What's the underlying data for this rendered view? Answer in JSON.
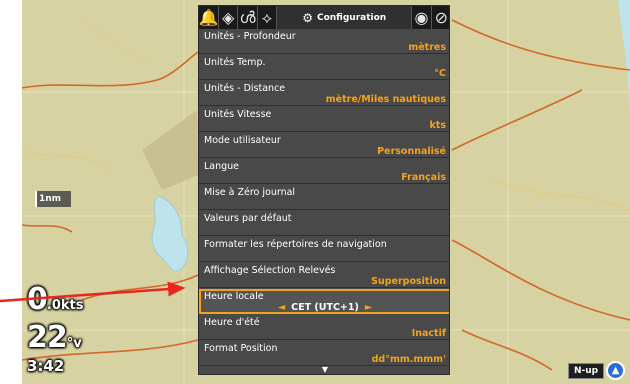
{
  "map": {
    "scale_label": "1nm",
    "orientation_label": "N-up",
    "colors": {
      "land": "#d7d2a2",
      "water": "#bfe3ec",
      "road": "#d4672b",
      "grid": "#ffffff"
    }
  },
  "readouts": {
    "speed_value": "0",
    "speed_unit": ".0kts",
    "depth_value": "22",
    "depth_unit": "°v",
    "time": "3:42"
  },
  "menu": {
    "tabs": [
      {
        "icon": "bell-icon",
        "glyph": "🔔"
      },
      {
        "icon": "navigation-icon",
        "glyph": "◈"
      },
      {
        "icon": "fish-icon",
        "glyph": "ൾ"
      },
      {
        "icon": "antenna-icon",
        "glyph": "⟡"
      }
    ],
    "active_tab": {
      "icon": "gear-icon",
      "glyph": "⚙",
      "label": "Configuration"
    },
    "right_tabs": [
      {
        "icon": "eye-icon",
        "glyph": "◉"
      },
      {
        "icon": "sonar-icon",
        "glyph": "⊘"
      }
    ],
    "items": [
      {
        "label": "Unités - Profondeur",
        "value": "mètres"
      },
      {
        "label": "Unités Temp.",
        "value": "°C"
      },
      {
        "label": "Unités - Distance",
        "value": "mètre/Miles nautiques"
      },
      {
        "label": "Unités Vitesse",
        "value": "kts"
      },
      {
        "label": "Mode utilisateur",
        "value": "Personnalisé"
      },
      {
        "label": "Langue",
        "value": "Français"
      },
      {
        "label": "Mise à Zéro journal",
        "value": ""
      },
      {
        "label": "Valeurs par défaut",
        "value": ""
      },
      {
        "label": "Formater les répertoires de navigation",
        "value": ""
      },
      {
        "label": "Affichage Sélection Relevés",
        "value": "Superposition"
      },
      {
        "label": "Heure locale",
        "value": "CET (UTC+1)",
        "selected": true
      },
      {
        "label": "Heure d'été",
        "value": "Inactif"
      },
      {
        "label": "Format Position",
        "value": "dd°mm.mmm'"
      }
    ],
    "selected_value_arrows": {
      "left": "◄",
      "right": "►"
    },
    "scroll_glyph": "▼",
    "accent_color": "#f5a21b"
  },
  "annotation": {
    "color": "#e8261f"
  }
}
